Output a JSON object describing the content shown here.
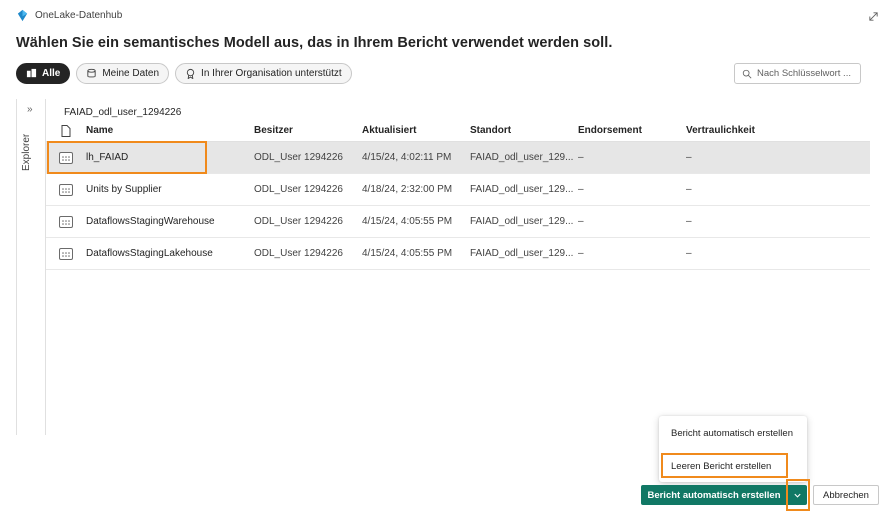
{
  "app": {
    "name": "OneLake-Datenhub",
    "icon": "onelake-icon"
  },
  "header": {
    "title": "Wählen Sie ein semantisches Modell aus, das in Ihrem Bericht verwendet werden soll.",
    "expand_icon": "expand-icon"
  },
  "filters": [
    {
      "label": "Alle",
      "icon": "all-items-icon",
      "active": true
    },
    {
      "label": "Meine Daten",
      "icon": "database-icon",
      "active": false
    },
    {
      "label": "In Ihrer Organisation unterstützt",
      "icon": "endorsed-badge-icon",
      "active": false
    }
  ],
  "search": {
    "placeholder": "Nach Schlüsselwort ...",
    "icon": "search-icon"
  },
  "explorer": {
    "label": "Explorer",
    "expand_icon": "double-chevron-right-icon"
  },
  "breadcrumb": "FAIAD_odl_user_1294226",
  "table": {
    "columns": [
      "Name",
      "Besitzer",
      "Aktualisiert",
      "Standort",
      "Endorsement",
      "Vertraulichkeit"
    ],
    "rows": [
      {
        "name": "lh_FAIAD",
        "owner": "ODL_User 1294226",
        "updated": "4/15/24, 4:02:11 PM",
        "location": "FAIAD_odl_user_129...",
        "endorsement": "–",
        "sensitivity": "–",
        "selected": true
      },
      {
        "name": "Units by Supplier",
        "owner": "ODL_User 1294226",
        "updated": "4/18/24, 2:32:00 PM",
        "location": "FAIAD_odl_user_129...",
        "endorsement": "–",
        "sensitivity": "–",
        "selected": false
      },
      {
        "name": "DataflowsStagingWarehouse",
        "owner": "ODL_User 1294226",
        "updated": "4/15/24, 4:05:55 PM",
        "location": "FAIAD_odl_user_129...",
        "endorsement": "–",
        "sensitivity": "–",
        "selected": false
      },
      {
        "name": "DataflowsStagingLakehouse",
        "owner": "ODL_User 1294226",
        "updated": "4/15/24, 4:05:55 PM",
        "location": "FAIAD_odl_user_129...",
        "endorsement": "–",
        "sensitivity": "–",
        "selected": false
      }
    ]
  },
  "dropdown_menu": {
    "items": [
      "Bericht automatisch erstellen",
      "Leeren Bericht erstellen"
    ]
  },
  "footer": {
    "primary_label": "Bericht automatisch erstellen",
    "split_icon": "chevron-down-icon",
    "cancel_label": "Abbrechen"
  },
  "colors": {
    "primary": "#117865",
    "highlight": "#f08a1c",
    "selected_row": "#e6e6e6"
  }
}
